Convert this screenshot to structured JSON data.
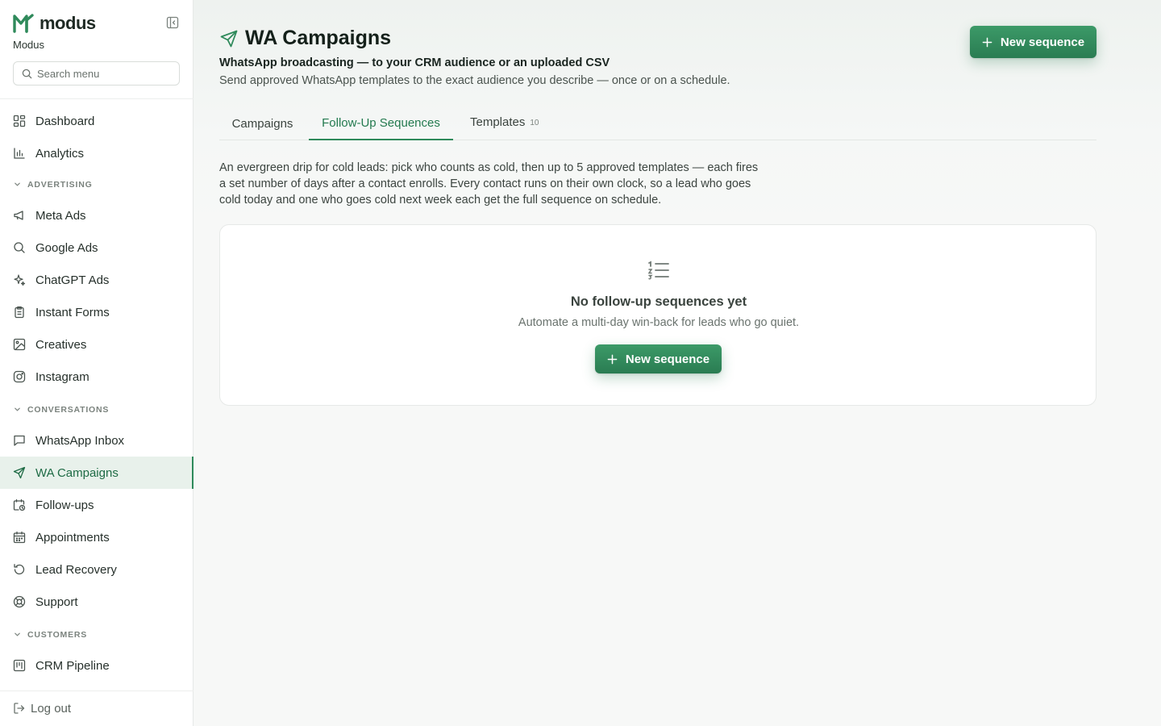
{
  "brand": {
    "wordmark": "modus",
    "workspace": "Modus"
  },
  "search": {
    "placeholder": "Search menu"
  },
  "nav": {
    "top": [
      {
        "label": "Dashboard",
        "icon": "grid-icon"
      },
      {
        "label": "Analytics",
        "icon": "bar-chart-icon"
      }
    ],
    "sections": [
      {
        "title": "ADVERTISING",
        "items": [
          {
            "label": "Meta Ads",
            "icon": "megaphone-icon"
          },
          {
            "label": "Google Ads",
            "icon": "search-icon"
          },
          {
            "label": "ChatGPT Ads",
            "icon": "sparkles-icon"
          },
          {
            "label": "Instant Forms",
            "icon": "clipboard-icon"
          },
          {
            "label": "Creatives",
            "icon": "image-icon"
          },
          {
            "label": "Instagram",
            "icon": "instagram-icon"
          }
        ]
      },
      {
        "title": "CONVERSATIONS",
        "items": [
          {
            "label": "WhatsApp Inbox",
            "icon": "message-square-icon"
          },
          {
            "label": "WA Campaigns",
            "icon": "send-icon",
            "active": true
          },
          {
            "label": "Follow-ups",
            "icon": "calendar-clock-icon"
          },
          {
            "label": "Appointments",
            "icon": "calendar-icon"
          },
          {
            "label": "Lead Recovery",
            "icon": "rotate-ccw-icon"
          },
          {
            "label": "Support",
            "icon": "life-buoy-icon"
          }
        ]
      },
      {
        "title": "CUSTOMERS",
        "items": [
          {
            "label": "CRM Pipeline",
            "icon": "kanban-icon"
          }
        ]
      }
    ],
    "logout": "Log out"
  },
  "header": {
    "title": "WA Campaigns",
    "subtitle_strong": "WhatsApp broadcasting — to your CRM audience or an uploaded CSV",
    "subtitle": "Send approved WhatsApp templates to the exact audience you describe — once or on a schedule.",
    "new_button": "New sequence"
  },
  "tabs": [
    {
      "label": "Campaigns"
    },
    {
      "label": "Follow-Up Sequences",
      "active": true
    },
    {
      "label": "Templates",
      "count": "10"
    }
  ],
  "description": "An evergreen drip for cold leads: pick who counts as cold, then up to 5 approved templates — each fires a set number of days after a contact enrolls. Every contact runs on their own clock, so a lead who goes cold today and one who goes cold next week each get the full sequence on schedule.",
  "empty_state": {
    "icon": "list-ordered-icon",
    "title": "No follow-up sequences yet",
    "subtitle": "Automate a multi-day win-back for leads who go quiet.",
    "button": "New sequence"
  },
  "colors": {
    "accent": "#2f8a5b",
    "accent_dark": "#2a7c52",
    "active_bg": "#e8f1eb"
  }
}
